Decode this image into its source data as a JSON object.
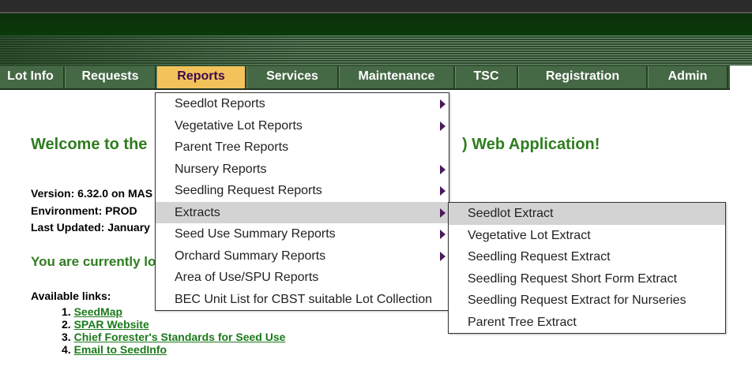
{
  "nav": {
    "items": [
      {
        "label": "Lot Info"
      },
      {
        "label": "Requests"
      },
      {
        "label": "Reports"
      },
      {
        "label": "Services"
      },
      {
        "label": "Maintenance"
      },
      {
        "label": "TSC"
      },
      {
        "label": "Registration"
      },
      {
        "label": "Admin"
      }
    ],
    "active": "Reports"
  },
  "main": {
    "welcome_left": "Welcome to the",
    "welcome_right": ") Web Application!",
    "version": "Version: 6.32.0 on MAS",
    "environment": "Environment: PROD",
    "last_updated": "Last Updated: January",
    "logged_in": "You are currently lo",
    "available_links": "Available links:",
    "links": [
      {
        "num": "1.",
        "label": "SeedMap"
      },
      {
        "num": "2.",
        "label": "SPAR Website"
      },
      {
        "num": "3.",
        "label": "Chief Forester's Standards for Seed Use"
      },
      {
        "num": "4.",
        "label": "Email to SeedInfo"
      }
    ]
  },
  "reports_menu": {
    "items": [
      {
        "label": "Seedlot Reports",
        "has_submenu": true
      },
      {
        "label": "Vegetative Lot Reports",
        "has_submenu": true
      },
      {
        "label": "Parent Tree Reports",
        "has_submenu": false
      },
      {
        "label": "Nursery Reports",
        "has_submenu": true
      },
      {
        "label": "Seedling Request Reports",
        "has_submenu": true
      },
      {
        "label": "Extracts",
        "has_submenu": true,
        "highlighted": true
      },
      {
        "label": "Seed Use Summary Reports",
        "has_submenu": true
      },
      {
        "label": "Orchard Summary Reports",
        "has_submenu": true
      },
      {
        "label": "Area of Use/SPU Reports",
        "has_submenu": false
      },
      {
        "label": "BEC Unit List for CBST suitable Lot Collection",
        "has_submenu": false
      }
    ]
  },
  "extracts_menu": {
    "items": [
      {
        "label": "Seedlot Extract",
        "highlighted": true
      },
      {
        "label": "Vegetative Lot Extract"
      },
      {
        "label": "Seedling Request Extract"
      },
      {
        "label": "Seedling Request Short Form Extract"
      },
      {
        "label": "Seedling Request Extract for Nurseries"
      },
      {
        "label": "Parent Tree Extract"
      }
    ]
  },
  "colors": {
    "nav_bg": "#456845",
    "nav_active": "#f4c25b",
    "welcome_green": "#2e7d1f",
    "link_green": "#1b7a1b",
    "menu_highlight": "#d3d3d3"
  }
}
